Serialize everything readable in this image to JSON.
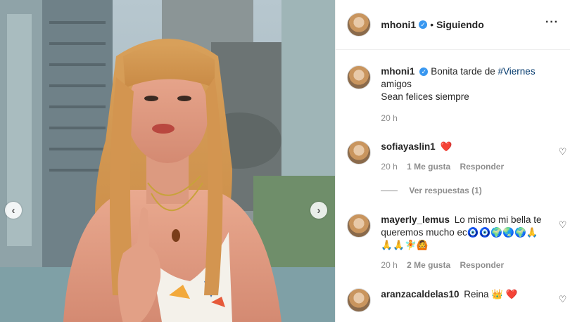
{
  "post": {
    "author": "mhoni1",
    "separator": "•",
    "follow_status": "Siguiendo",
    "more_icon": "more-horizontal-icon",
    "verified_icon": "verified-badge-icon"
  },
  "caption": {
    "username": "mhoni1",
    "text_before": "Bonita tarde de",
    "hashtag": "#Viernes",
    "line2": "amigos",
    "line3": "Sean felices siempre",
    "time": "20 h"
  },
  "comments": [
    {
      "username": "sofiayaslin1",
      "text": "❤️",
      "time": "20 h",
      "likes": "1 Me gusta",
      "reply": "Responder",
      "replies_label": "Ver respuestas (1)"
    },
    {
      "username": "mayerly_lemus",
      "text": "Lo mismo mi bella te queremos mucho ec🧿🧿🌍🌏🌍🙏🙏🙏🧚🙆",
      "time": "20 h",
      "likes": "2 Me gusta",
      "reply": "Responder"
    },
    {
      "username": "aranzacaldelas10",
      "text": "Reina 👑 ❤️"
    }
  ],
  "media": {
    "prev_label": "‹",
    "next_label": "›"
  },
  "colors": {
    "link": "#00376b",
    "muted": "#8e8e8e",
    "verified": "#3897f0",
    "heart": "#ed1c2e"
  }
}
